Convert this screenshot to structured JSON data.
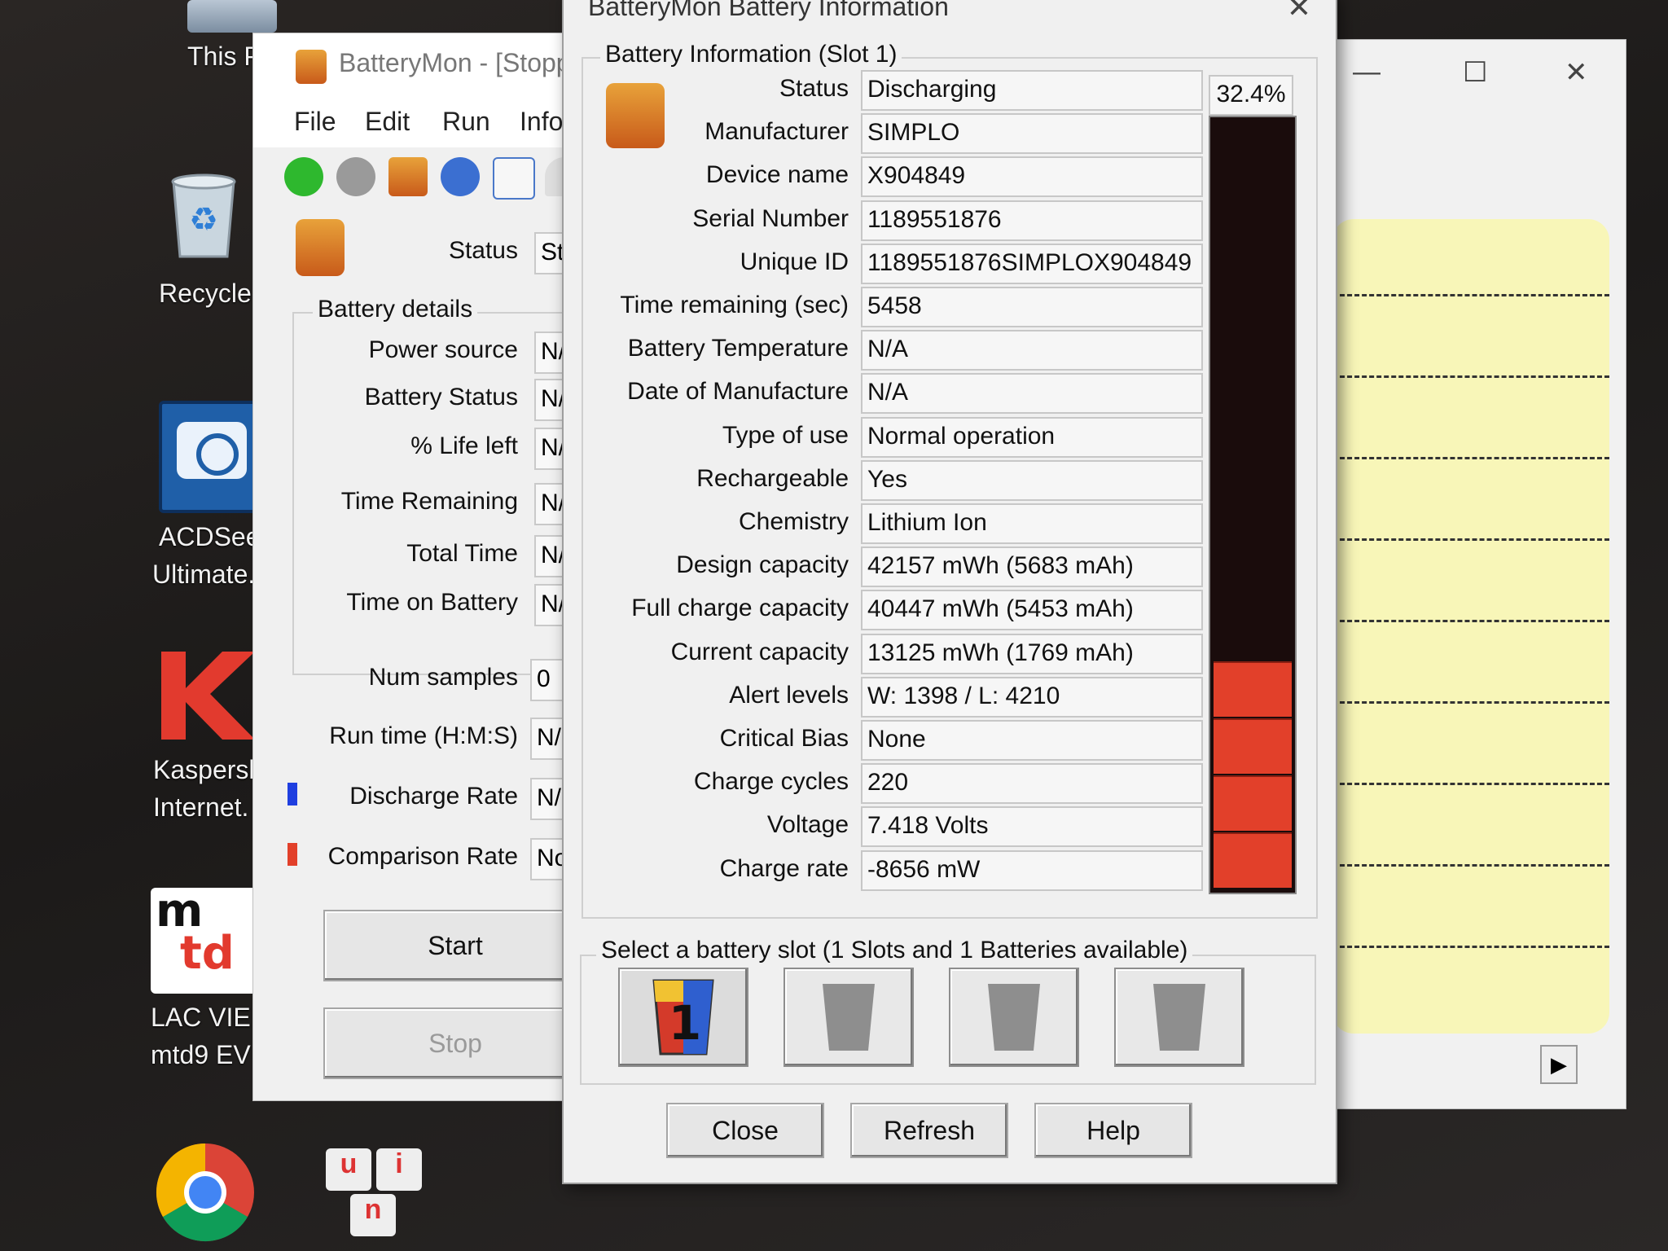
{
  "desktop": {
    "icons": [
      {
        "label_1": "This PC",
        "label_2": ""
      },
      {
        "label_1": "Recycle B",
        "label_2": ""
      },
      {
        "label_1": "ACDSee",
        "label_2": "Ultimate."
      },
      {
        "label_1": "Kaspersk",
        "label_2": "Internet."
      },
      {
        "label_1": "LAC VIE",
        "label_2": "mtd9 EV"
      }
    ],
    "unikey": {
      "u": "u",
      "i": "i",
      "n": "n"
    }
  },
  "main_window": {
    "title": "BatteryMon - [Stopp",
    "menu": [
      "File",
      "Edit",
      "Run",
      "Info"
    ],
    "status_label": "Status",
    "status_value": "Sto",
    "group_title": "Battery details",
    "details": [
      {
        "label": "Power source",
        "value": "N/"
      },
      {
        "label": "Battery Status",
        "value": "N/"
      },
      {
        "label": "% Life left",
        "value": "N/"
      },
      {
        "label": "Time Remaining",
        "value": "N/"
      },
      {
        "label": "Total Time",
        "value": "N/"
      },
      {
        "label": "Time on Battery",
        "value": "N/"
      }
    ],
    "num_samples_label": "Num samples",
    "num_samples_value": "0",
    "run_time_label": "Run time (H:M:S)",
    "run_time_value": "N/",
    "discharge_rate_label": "Discharge Rate",
    "discharge_rate_value": "N/",
    "comparison_rate_label": "Comparison Rate",
    "comparison_rate_value": "No",
    "start_label": "Start",
    "stop_label": "Stop",
    "colors": {
      "discharge": "#1f3fe0",
      "comparison": "#e2402a"
    }
  },
  "dialog": {
    "title": "BatteryMon Battery Information",
    "group_title": "Battery Information (Slot 1)",
    "fields": [
      {
        "label": "Status",
        "value": "Discharging"
      },
      {
        "label": "Manufacturer",
        "value": "SIMPLO"
      },
      {
        "label": "Device name",
        "value": "X904849"
      },
      {
        "label": "Serial Number",
        "value": "1189551876"
      },
      {
        "label": "Unique ID",
        "value": "1189551876SIMPLOX904849"
      },
      {
        "label": "Time remaining (sec)",
        "value": "5458"
      },
      {
        "label": "Battery Temperature",
        "value": "N/A"
      },
      {
        "label": "Date of Manufacture",
        "value": "N/A"
      },
      {
        "label": "Type of use",
        "value": "Normal operation"
      },
      {
        "label": "Rechargeable",
        "value": "Yes"
      },
      {
        "label": "Chemistry",
        "value": "Lithium Ion"
      },
      {
        "label": "Design capacity",
        "value": "42157 mWh (5683 mAh)"
      },
      {
        "label": "Full charge capacity",
        "value": "40447 mWh (5453 mAh)"
      },
      {
        "label": "Current capacity",
        "value": "13125 mWh (1769 mAh)"
      },
      {
        "label": "Alert levels",
        "value": "W: 1398 / L: 4210"
      },
      {
        "label": "Critical Bias",
        "value": "None"
      },
      {
        "label": "Charge cycles",
        "value": "220"
      },
      {
        "label": "Voltage",
        "value": "7.418 Volts"
      },
      {
        "label": "Charge rate",
        "value": "-8656 mW"
      }
    ],
    "charge_percent": "32.4%",
    "charge_fraction": 0.324,
    "slot_group_title": "Select a battery slot (1 Slots and 1 Batteries available)",
    "slot_active_number": "1",
    "close_label": "Close",
    "refresh_label": "Refresh",
    "help_label": "Help",
    "gauge_color": "#e2402a"
  }
}
